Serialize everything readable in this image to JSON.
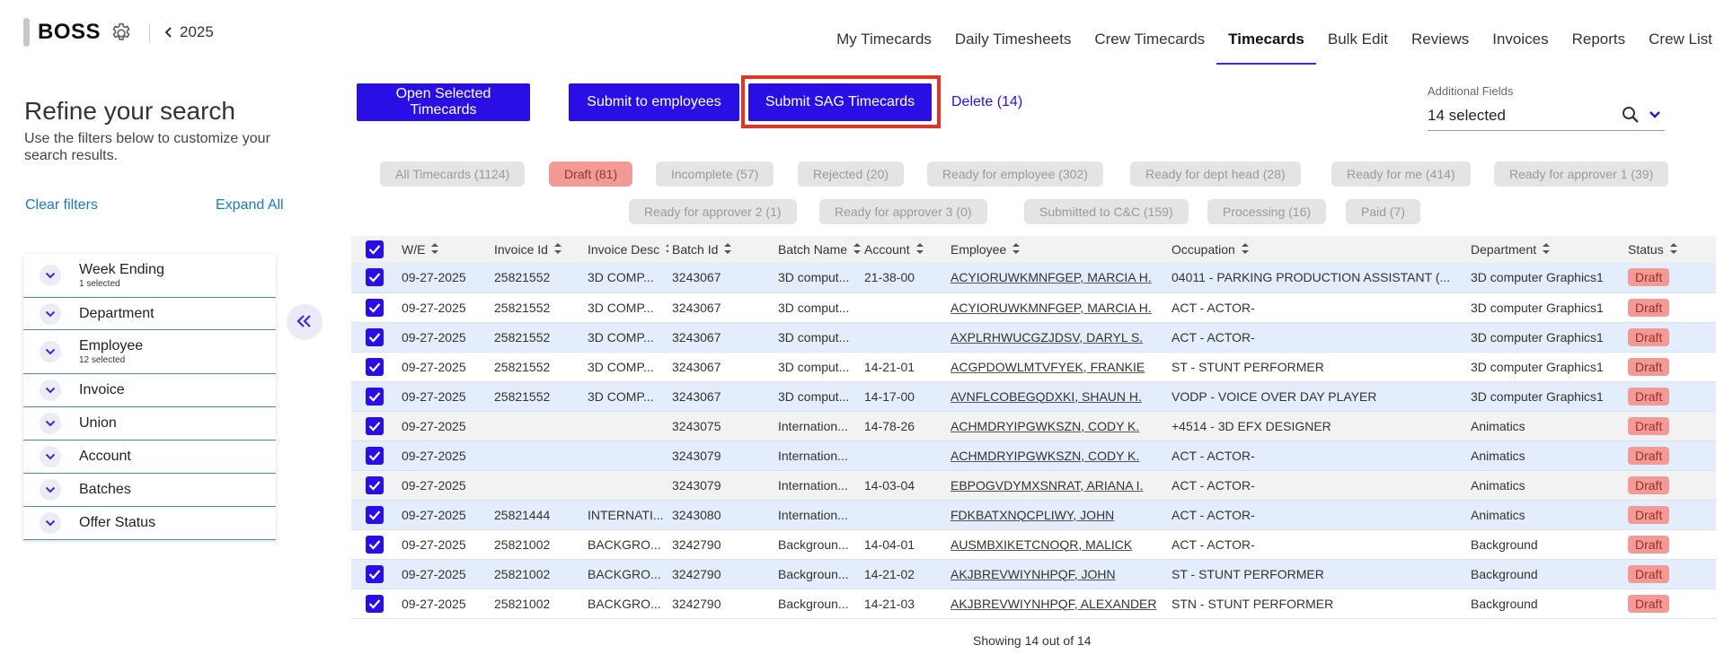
{
  "header": {
    "brand": "BOSS",
    "year": "2025",
    "tabs": [
      {
        "label": "My Timecards",
        "active": false
      },
      {
        "label": "Daily Timesheets",
        "active": false
      },
      {
        "label": "Crew Timecards",
        "active": false
      },
      {
        "label": "Timecards",
        "active": true
      },
      {
        "label": "Bulk Edit",
        "active": false
      },
      {
        "label": "Reviews",
        "active": false
      },
      {
        "label": "Invoices",
        "active": false
      },
      {
        "label": "Reports",
        "active": false
      },
      {
        "label": "Crew List",
        "active": false
      }
    ]
  },
  "sidebar": {
    "title": "Refine your search",
    "subtitle": "Use the filters below to customize your search results.",
    "clear_label": "Clear filters",
    "expand_label": "Expand All",
    "filters": [
      {
        "label": "Week Ending",
        "sub": "1 selected"
      },
      {
        "label": "Department",
        "sub": ""
      },
      {
        "label": "Employee",
        "sub": "12 selected"
      },
      {
        "label": "Invoice",
        "sub": ""
      },
      {
        "label": "Union",
        "sub": ""
      },
      {
        "label": "Account",
        "sub": ""
      },
      {
        "label": "Batches",
        "sub": ""
      },
      {
        "label": "Offer Status",
        "sub": ""
      }
    ]
  },
  "actions": {
    "open_label": "Open Selected Timecards",
    "submit_emp_label": "Submit to employees",
    "submit_sag_label": "Submit SAG Timecards",
    "delete_label": "Delete (14)"
  },
  "additional_fields": {
    "label": "Additional Fields",
    "value": "14 selected"
  },
  "status_chips": [
    {
      "label": "All Timecards (1124)",
      "active": false
    },
    {
      "label": "Draft (81)",
      "active": true
    },
    {
      "label": "Incomplete (57)",
      "active": false
    },
    {
      "label": "Rejected (20)",
      "active": false
    },
    {
      "label": "Ready for employee (302)",
      "active": false
    },
    {
      "label": "Ready for dept head (28)",
      "active": false
    },
    {
      "label": "Ready for me (414)",
      "active": false
    },
    {
      "label": "Ready for approver 1 (39)",
      "active": false
    },
    {
      "label": "Ready for approver 2 (1)",
      "active": false
    },
    {
      "label": "Ready for approver 3 (0)",
      "active": false
    },
    {
      "label": "Submitted to C&C (159)",
      "active": false
    },
    {
      "label": "Processing (16)",
      "active": false
    },
    {
      "label": "Paid (7)",
      "active": false
    }
  ],
  "table": {
    "columns": [
      "W/E",
      "Invoice Id",
      "Invoice Desc",
      "Batch Id",
      "Batch Name",
      "Account",
      "Employee",
      "Occupation",
      "Department",
      "Status"
    ],
    "rows": [
      {
        "we": "09-27-2025",
        "invoice_id": "25821552",
        "invoice_desc": "3D COMP...",
        "batch_id": "3243067",
        "batch_name": "3D comput...",
        "account": "21-38-00",
        "employee": "ACYIORUWKMNFGEP, MARCIA H.",
        "occupation": "04011 - PARKING PRODUCTION ASSISTANT (...",
        "department": "3D computer Graphics1",
        "status": "Draft"
      },
      {
        "we": "09-27-2025",
        "invoice_id": "25821552",
        "invoice_desc": "3D COMP...",
        "batch_id": "3243067",
        "batch_name": "3D comput...",
        "account": "",
        "employee": "ACYIORUWKMNFGEP, MARCIA H.",
        "occupation": "ACT - ACTOR-",
        "department": "3D computer Graphics1",
        "status": "Draft"
      },
      {
        "we": "09-27-2025",
        "invoice_id": "25821552",
        "invoice_desc": "3D COMP...",
        "batch_id": "3243067",
        "batch_name": "3D comput...",
        "account": "",
        "employee": "AXPLRHWUCGZJDSV, DARYL S.",
        "occupation": "ACT - ACTOR-",
        "department": "3D computer Graphics1",
        "status": "Draft"
      },
      {
        "we": "09-27-2025",
        "invoice_id": "25821552",
        "invoice_desc": "3D COMP...",
        "batch_id": "3243067",
        "batch_name": "3D comput...",
        "account": "14-21-01",
        "employee": "ACGPDOWLMTVFYEK, FRANKIE",
        "occupation": "ST - STUNT PERFORMER",
        "department": "3D computer Graphics1",
        "status": "Draft"
      },
      {
        "we": "09-27-2025",
        "invoice_id": "25821552",
        "invoice_desc": "3D COMP...",
        "batch_id": "3243067",
        "batch_name": "3D comput...",
        "account": "14-17-00",
        "employee": "AVNFLCOBEGQDXKI, SHAUN H.",
        "occupation": "VODP - VOICE OVER DAY PLAYER",
        "department": "3D computer Graphics1",
        "status": "Draft"
      },
      {
        "we": "09-27-2025",
        "invoice_id": "",
        "invoice_desc": "",
        "batch_id": "3243075",
        "batch_name": "Internation...",
        "account": "14-78-26",
        "employee": "ACHMDRYIPGWKSZN, CODY K.",
        "occupation": "+4514 - 3D EFX DESIGNER",
        "department": "Animatics",
        "status": "Draft"
      },
      {
        "we": "09-27-2025",
        "invoice_id": "",
        "invoice_desc": "",
        "batch_id": "3243079",
        "batch_name": "Internation...",
        "account": "",
        "employee": "ACHMDRYIPGWKSZN, CODY K.",
        "occupation": "ACT - ACTOR-",
        "department": "Animatics",
        "status": "Draft"
      },
      {
        "we": "09-27-2025",
        "invoice_id": "",
        "invoice_desc": "",
        "batch_id": "3243079",
        "batch_name": "Internation...",
        "account": "14-03-04",
        "employee": "EBPOGVDYMXSNRAT, ARIANA I.",
        "occupation": "ACT - ACTOR-",
        "department": "Animatics",
        "status": "Draft"
      },
      {
        "we": "09-27-2025",
        "invoice_id": "25821444",
        "invoice_desc": "INTERNATI...",
        "batch_id": "3243080",
        "batch_name": "Internation...",
        "account": "",
        "employee": "FDKBATXNQCPLIWY, JOHN",
        "occupation": "ACT - ACTOR-",
        "department": "Animatics",
        "status": "Draft"
      },
      {
        "we": "09-27-2025",
        "invoice_id": "25821002",
        "invoice_desc": "BACKGRO...",
        "batch_id": "3242790",
        "batch_name": "Backgroun...",
        "account": "14-04-01",
        "employee": "AUSMBXIKETCNOQR, MALICK",
        "occupation": "ACT - ACTOR-",
        "department": "Background",
        "status": "Draft"
      },
      {
        "we": "09-27-2025",
        "invoice_id": "25821002",
        "invoice_desc": "BACKGRO...",
        "batch_id": "3242790",
        "batch_name": "Backgroun...",
        "account": "14-21-02",
        "employee": "AKJBREVWIYNHPQF, JOHN",
        "occupation": "ST - STUNT PERFORMER",
        "department": "Background",
        "status": "Draft"
      },
      {
        "we": "09-27-2025",
        "invoice_id": "25821002",
        "invoice_desc": "BACKGRO...",
        "batch_id": "3242790",
        "batch_name": "Backgroun...",
        "account": "14-21-03",
        "employee": "AKJBREVWIYNHPQF, ALEXANDER",
        "occupation": "STN - STUNT PERFORMER",
        "department": "Background",
        "status": "Draft"
      }
    ],
    "footer": "Showing 14 out of 14"
  },
  "colors": {
    "primary": "#2a0ee6",
    "highlight": "#e53222",
    "draft_badge": "#f29a95",
    "row_alt": "#e3edfb",
    "link": "#1a7bbf"
  }
}
